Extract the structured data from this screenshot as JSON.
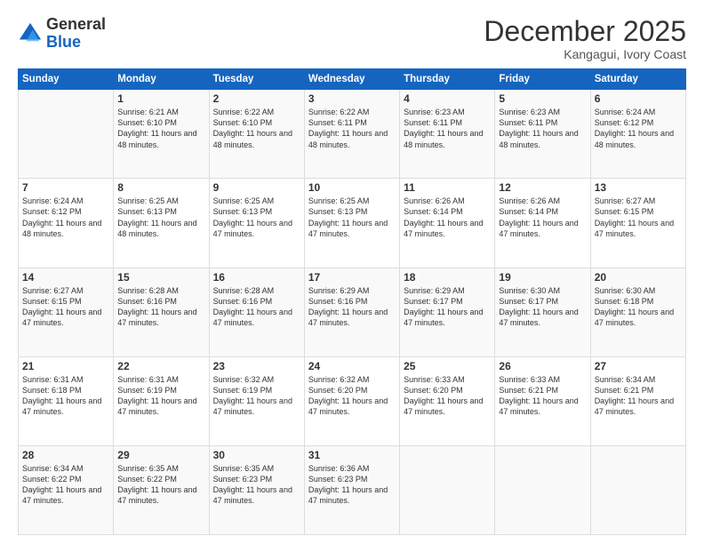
{
  "logo": {
    "general": "General",
    "blue": "Blue"
  },
  "header": {
    "month": "December 2025",
    "location": "Kangagui, Ivory Coast"
  },
  "weekdays": [
    "Sunday",
    "Monday",
    "Tuesday",
    "Wednesday",
    "Thursday",
    "Friday",
    "Saturday"
  ],
  "weeks": [
    [
      {
        "day": "",
        "sunrise": "",
        "sunset": "",
        "daylight": ""
      },
      {
        "day": "1",
        "sunrise": "Sunrise: 6:21 AM",
        "sunset": "Sunset: 6:10 PM",
        "daylight": "Daylight: 11 hours and 48 minutes."
      },
      {
        "day": "2",
        "sunrise": "Sunrise: 6:22 AM",
        "sunset": "Sunset: 6:10 PM",
        "daylight": "Daylight: 11 hours and 48 minutes."
      },
      {
        "day": "3",
        "sunrise": "Sunrise: 6:22 AM",
        "sunset": "Sunset: 6:11 PM",
        "daylight": "Daylight: 11 hours and 48 minutes."
      },
      {
        "day": "4",
        "sunrise": "Sunrise: 6:23 AM",
        "sunset": "Sunset: 6:11 PM",
        "daylight": "Daylight: 11 hours and 48 minutes."
      },
      {
        "day": "5",
        "sunrise": "Sunrise: 6:23 AM",
        "sunset": "Sunset: 6:11 PM",
        "daylight": "Daylight: 11 hours and 48 minutes."
      },
      {
        "day": "6",
        "sunrise": "Sunrise: 6:24 AM",
        "sunset": "Sunset: 6:12 PM",
        "daylight": "Daylight: 11 hours and 48 minutes."
      }
    ],
    [
      {
        "day": "7",
        "sunrise": "Sunrise: 6:24 AM",
        "sunset": "Sunset: 6:12 PM",
        "daylight": "Daylight: 11 hours and 48 minutes."
      },
      {
        "day": "8",
        "sunrise": "Sunrise: 6:25 AM",
        "sunset": "Sunset: 6:13 PM",
        "daylight": "Daylight: 11 hours and 48 minutes."
      },
      {
        "day": "9",
        "sunrise": "Sunrise: 6:25 AM",
        "sunset": "Sunset: 6:13 PM",
        "daylight": "Daylight: 11 hours and 47 minutes."
      },
      {
        "day": "10",
        "sunrise": "Sunrise: 6:25 AM",
        "sunset": "Sunset: 6:13 PM",
        "daylight": "Daylight: 11 hours and 47 minutes."
      },
      {
        "day": "11",
        "sunrise": "Sunrise: 6:26 AM",
        "sunset": "Sunset: 6:14 PM",
        "daylight": "Daylight: 11 hours and 47 minutes."
      },
      {
        "day": "12",
        "sunrise": "Sunrise: 6:26 AM",
        "sunset": "Sunset: 6:14 PM",
        "daylight": "Daylight: 11 hours and 47 minutes."
      },
      {
        "day": "13",
        "sunrise": "Sunrise: 6:27 AM",
        "sunset": "Sunset: 6:15 PM",
        "daylight": "Daylight: 11 hours and 47 minutes."
      }
    ],
    [
      {
        "day": "14",
        "sunrise": "Sunrise: 6:27 AM",
        "sunset": "Sunset: 6:15 PM",
        "daylight": "Daylight: 11 hours and 47 minutes."
      },
      {
        "day": "15",
        "sunrise": "Sunrise: 6:28 AM",
        "sunset": "Sunset: 6:16 PM",
        "daylight": "Daylight: 11 hours and 47 minutes."
      },
      {
        "day": "16",
        "sunrise": "Sunrise: 6:28 AM",
        "sunset": "Sunset: 6:16 PM",
        "daylight": "Daylight: 11 hours and 47 minutes."
      },
      {
        "day": "17",
        "sunrise": "Sunrise: 6:29 AM",
        "sunset": "Sunset: 6:16 PM",
        "daylight": "Daylight: 11 hours and 47 minutes."
      },
      {
        "day": "18",
        "sunrise": "Sunrise: 6:29 AM",
        "sunset": "Sunset: 6:17 PM",
        "daylight": "Daylight: 11 hours and 47 minutes."
      },
      {
        "day": "19",
        "sunrise": "Sunrise: 6:30 AM",
        "sunset": "Sunset: 6:17 PM",
        "daylight": "Daylight: 11 hours and 47 minutes."
      },
      {
        "day": "20",
        "sunrise": "Sunrise: 6:30 AM",
        "sunset": "Sunset: 6:18 PM",
        "daylight": "Daylight: 11 hours and 47 minutes."
      }
    ],
    [
      {
        "day": "21",
        "sunrise": "Sunrise: 6:31 AM",
        "sunset": "Sunset: 6:18 PM",
        "daylight": "Daylight: 11 hours and 47 minutes."
      },
      {
        "day": "22",
        "sunrise": "Sunrise: 6:31 AM",
        "sunset": "Sunset: 6:19 PM",
        "daylight": "Daylight: 11 hours and 47 minutes."
      },
      {
        "day": "23",
        "sunrise": "Sunrise: 6:32 AM",
        "sunset": "Sunset: 6:19 PM",
        "daylight": "Daylight: 11 hours and 47 minutes."
      },
      {
        "day": "24",
        "sunrise": "Sunrise: 6:32 AM",
        "sunset": "Sunset: 6:20 PM",
        "daylight": "Daylight: 11 hours and 47 minutes."
      },
      {
        "day": "25",
        "sunrise": "Sunrise: 6:33 AM",
        "sunset": "Sunset: 6:20 PM",
        "daylight": "Daylight: 11 hours and 47 minutes."
      },
      {
        "day": "26",
        "sunrise": "Sunrise: 6:33 AM",
        "sunset": "Sunset: 6:21 PM",
        "daylight": "Daylight: 11 hours and 47 minutes."
      },
      {
        "day": "27",
        "sunrise": "Sunrise: 6:34 AM",
        "sunset": "Sunset: 6:21 PM",
        "daylight": "Daylight: 11 hours and 47 minutes."
      }
    ],
    [
      {
        "day": "28",
        "sunrise": "Sunrise: 6:34 AM",
        "sunset": "Sunset: 6:22 PM",
        "daylight": "Daylight: 11 hours and 47 minutes."
      },
      {
        "day": "29",
        "sunrise": "Sunrise: 6:35 AM",
        "sunset": "Sunset: 6:22 PM",
        "daylight": "Daylight: 11 hours and 47 minutes."
      },
      {
        "day": "30",
        "sunrise": "Sunrise: 6:35 AM",
        "sunset": "Sunset: 6:23 PM",
        "daylight": "Daylight: 11 hours and 47 minutes."
      },
      {
        "day": "31",
        "sunrise": "Sunrise: 6:36 AM",
        "sunset": "Sunset: 6:23 PM",
        "daylight": "Daylight: 11 hours and 47 minutes."
      },
      {
        "day": "",
        "sunrise": "",
        "sunset": "",
        "daylight": ""
      },
      {
        "day": "",
        "sunrise": "",
        "sunset": "",
        "daylight": ""
      },
      {
        "day": "",
        "sunrise": "",
        "sunset": "",
        "daylight": ""
      }
    ]
  ]
}
